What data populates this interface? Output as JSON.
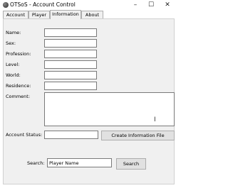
{
  "window": {
    "title": "OTSoS - Account Control",
    "icon": "app-icon",
    "controls": {
      "minimize": "–",
      "maximize": "☐",
      "close": "✕"
    }
  },
  "tabs": [
    {
      "label": "Account",
      "active": false
    },
    {
      "label": "Player",
      "active": false
    },
    {
      "label": "Information",
      "active": true
    },
    {
      "label": "About",
      "active": false
    }
  ],
  "form": {
    "name_label": "Name:",
    "sex_label": "Sex:",
    "profession_label": "Profession:",
    "level_label": "Level:",
    "world_label": "World:",
    "residence_label": "Residence:",
    "comment_label": "Comment:",
    "account_status_label": "Account Status:",
    "create_button": "Create Information File"
  },
  "search": {
    "label": "Search:",
    "value": "Player Name",
    "button": "Search"
  }
}
